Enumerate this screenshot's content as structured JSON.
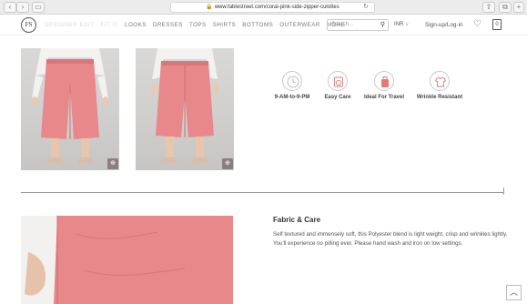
{
  "browser": {
    "url": "www.fablestreet.com/coral-pink-side-zipper-culottes"
  },
  "header": {
    "logo_text": "FS",
    "nav": [
      "DESIGNER EDIT",
      "FIT IT",
      "LOOKS",
      "DRESSES",
      "TOPS",
      "SHIRTS",
      "BOTTOMS",
      "OUTERWEAR",
      "MORE"
    ],
    "search_placeholder": "Search...",
    "currency": "INR",
    "signup": "Sign-up/Log-in",
    "bag_count": "0"
  },
  "features": [
    {
      "label": "9-AM-to-9-PM",
      "icon": "clock-icon",
      "color": "#999999"
    },
    {
      "label": "Easy Care",
      "icon": "washing-icon",
      "color": "#e07b6f"
    },
    {
      "label": "Ideal For Travel",
      "icon": "travel-icon",
      "color": "#e07b6f"
    },
    {
      "label": "Wrinkle Resistant",
      "icon": "shirt-icon",
      "color": "#e07b6f"
    }
  ],
  "fabric_care": {
    "title": "Fabric & Care",
    "body": "Self textured and immensely soft, this Polyester blend is light weight, crisp and wrinkles lightly. You'll experience no pilling ever. Please hand wash and iron on low settings."
  },
  "colors": {
    "pants": "#e8888a",
    "zoom_button": "#8c7f7f"
  }
}
